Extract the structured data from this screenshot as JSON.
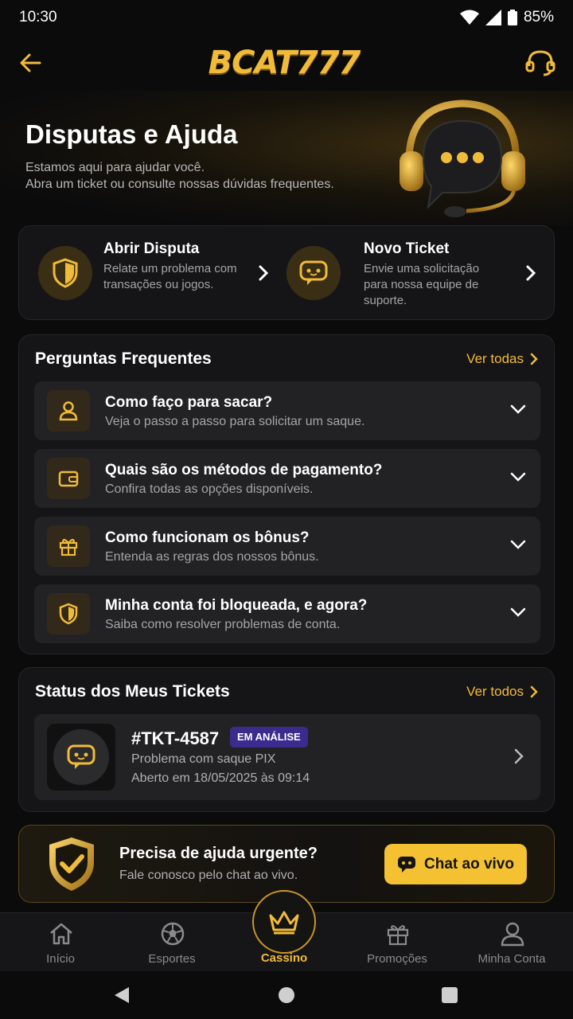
{
  "status_bar": {
    "time": "10:30",
    "battery": "85%"
  },
  "header": {
    "logo": "BCAT777",
    "icons": [
      "back-arrow-icon",
      "headset-icon"
    ]
  },
  "hero": {
    "title": "Disputas e Ajuda",
    "subtitle_line1": "Estamos aqui para ajudar você.",
    "subtitle_line2": "Abra um ticket ou consulte nossas dúvidas frequentes."
  },
  "actions": [
    {
      "title": "Abrir Disputa",
      "desc": "Relate um problema com transações ou jogos.",
      "icon": "shield-icon"
    },
    {
      "title": "Novo Ticket",
      "desc": "Envie uma solicitação para nossa equipe de suporte.",
      "icon": "chat-bubble-icon"
    }
  ],
  "faq": {
    "title": "Perguntas Frequentes",
    "see_all": "Ver todas",
    "items": [
      {
        "question": "Como faço para sacar?",
        "summary": "Veja o passo a passo para solicitar um saque.",
        "icon": "user-icon"
      },
      {
        "question": "Quais são os métodos de pagamento?",
        "summary": "Confira todas as opções disponíveis.",
        "icon": "wallet-icon"
      },
      {
        "question": "Como funcionam os bônus?",
        "summary": "Entenda as regras dos nossos bônus.",
        "icon": "gift-icon"
      },
      {
        "question": "Minha conta foi bloqueada, e agora?",
        "summary": "Saiba como resolver problemas de conta.",
        "icon": "shield-icon"
      }
    ]
  },
  "tickets": {
    "title": "Status dos Meus Tickets",
    "see_all": "Ver todos",
    "items": [
      {
        "id": "#TKT-4587",
        "status": "EM ANÁLISE",
        "subject": "Problema com saque PIX",
        "opened": "Aberto em 18/05/2025 às 09:14"
      }
    ]
  },
  "urgent": {
    "title": "Precisa de ajuda urgente?",
    "subtitle": "Fale conosco pelo chat ao vivo.",
    "button": "Chat ao vivo"
  },
  "bottom_nav": {
    "items": [
      {
        "label": "Início",
        "icon": "home-icon"
      },
      {
        "label": "Esportes",
        "icon": "soccer-ball-icon"
      },
      {
        "label": "Cassino",
        "icon": "crown-icon",
        "active": true
      },
      {
        "label": "Promoções",
        "icon": "gift-icon"
      },
      {
        "label": "Minha Conta",
        "icon": "user-icon"
      }
    ]
  },
  "colors": {
    "accent": "#f1bb3a",
    "background": "#0b0b0c",
    "card": "#151517",
    "badge": "#3b2b8f"
  }
}
